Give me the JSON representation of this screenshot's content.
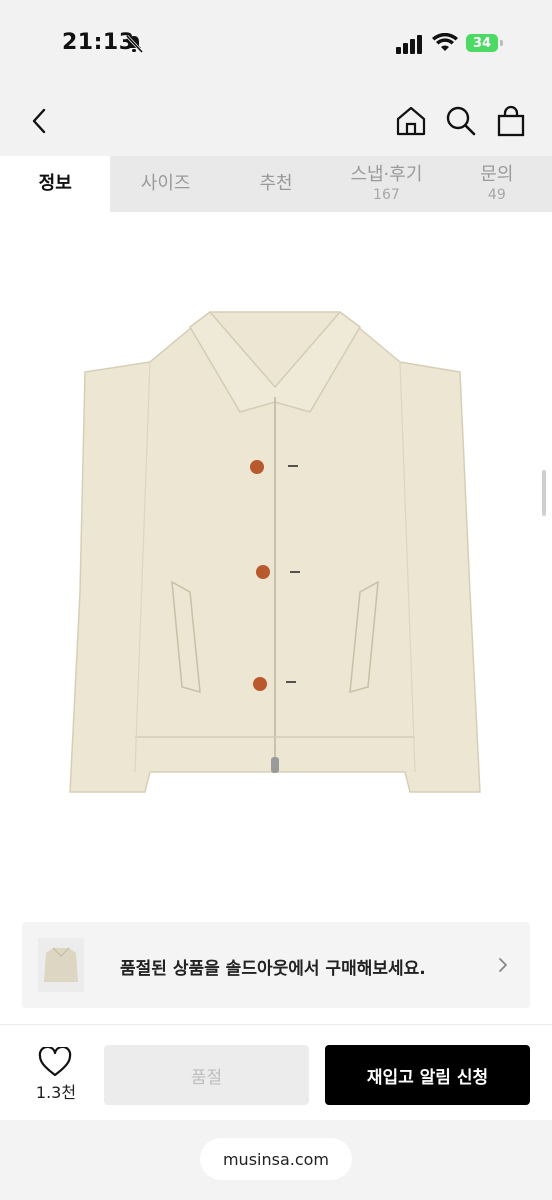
{
  "status": {
    "time": "21:13",
    "battery": "34"
  },
  "tabs": [
    {
      "label": "정보",
      "count": ""
    },
    {
      "label": "사이즈",
      "count": ""
    },
    {
      "label": "추천",
      "count": ""
    },
    {
      "label": "스냅·후기",
      "count": "167"
    },
    {
      "label": "문의",
      "count": "49"
    }
  ],
  "banner": {
    "text": "품절된 상품을 솔드아웃에서 구매해보세요."
  },
  "bottom": {
    "likes": "1.3천",
    "soldout_label": "품절",
    "restock_label": "재입고 알림 신청"
  },
  "browser": {
    "url": "musinsa.com"
  },
  "colors": {
    "jacket": "#ece6d2",
    "button": "#b85a2e",
    "accent_black": "#000000"
  }
}
